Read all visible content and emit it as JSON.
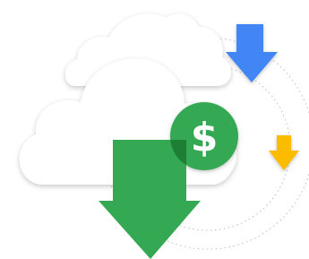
{
  "illustration": {
    "subject": "cloud-cost-savings",
    "icons": [
      "back-cloud-icon",
      "front-cloud-icon",
      "dollar-coin-icon",
      "large-download-arrow-icon",
      "blue-download-arrow-icon",
      "yellow-download-arrow-icon"
    ],
    "coin": {
      "symbol": "$"
    },
    "colors": {
      "background": "#ffffff",
      "cloud_fill": "#ffffff",
      "cloud_shadow": "#c8c8c8",
      "coin_green": "#34a853",
      "arrow_green": "#34a853",
      "overlap_green": "#1e7e34",
      "arrow_blue": "#4285f4",
      "arrow_yellow": "#fbbc04",
      "orbit_line": "#bdbdbd"
    }
  }
}
